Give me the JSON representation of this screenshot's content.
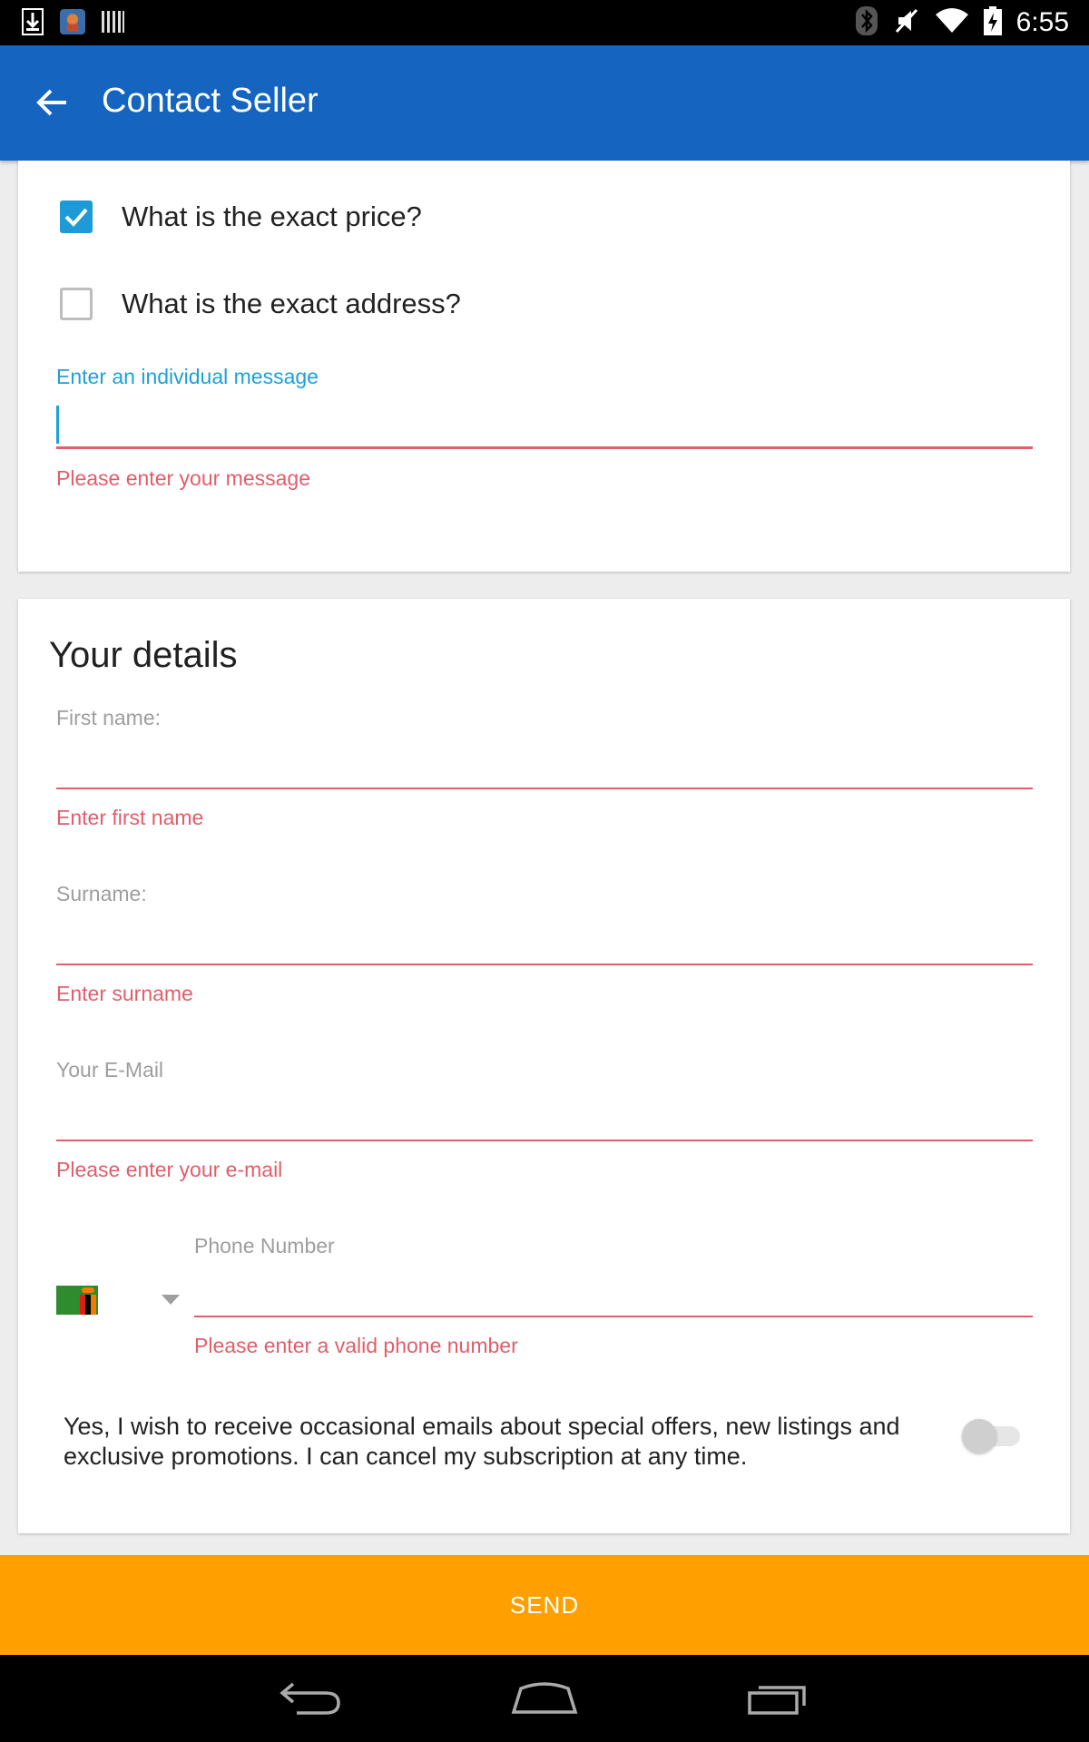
{
  "status_bar": {
    "time": "6:55",
    "left_icons": [
      "download-icon",
      "app-icon",
      "barcode-icon"
    ],
    "right_icons": [
      "bluetooth-icon",
      "mute-icon",
      "wifi-icon",
      "battery-icon"
    ]
  },
  "app_bar": {
    "title": "Contact Seller",
    "back_icon": "arrow-left-icon"
  },
  "questions": [
    {
      "label": "What is the exact price?",
      "checked": true
    },
    {
      "label": "What is the exact address?",
      "checked": false
    }
  ],
  "message": {
    "label": "Enter an individual message",
    "value": "",
    "error": "Please enter your message"
  },
  "details": {
    "title": "Your details",
    "first_name": {
      "label": "First name:",
      "value": "",
      "error": "Enter first name"
    },
    "surname": {
      "label": "Surname:",
      "value": "",
      "error": "Enter surname"
    },
    "email": {
      "label": "Your E-Mail",
      "value": "",
      "error": "Please enter your e-mail"
    },
    "phone": {
      "label": "Phone Number",
      "value": "",
      "error": "Please enter a valid phone number",
      "country_flag": "zambia-flag-icon"
    }
  },
  "newsletter": {
    "text": "Yes, I wish to receive occasional emails about special offers, new listings and exclusive promotions. I can cancel my subscription at any time.",
    "enabled": false
  },
  "send_button": {
    "label": "SEND"
  },
  "colors": {
    "app_bar": "#1565c0",
    "accent": "#1ea0d8",
    "error": "#e35d6a",
    "send": "#ffa000"
  },
  "nav_bar": {
    "icons": [
      "back-nav-icon",
      "home-nav-icon",
      "recents-nav-icon"
    ]
  }
}
